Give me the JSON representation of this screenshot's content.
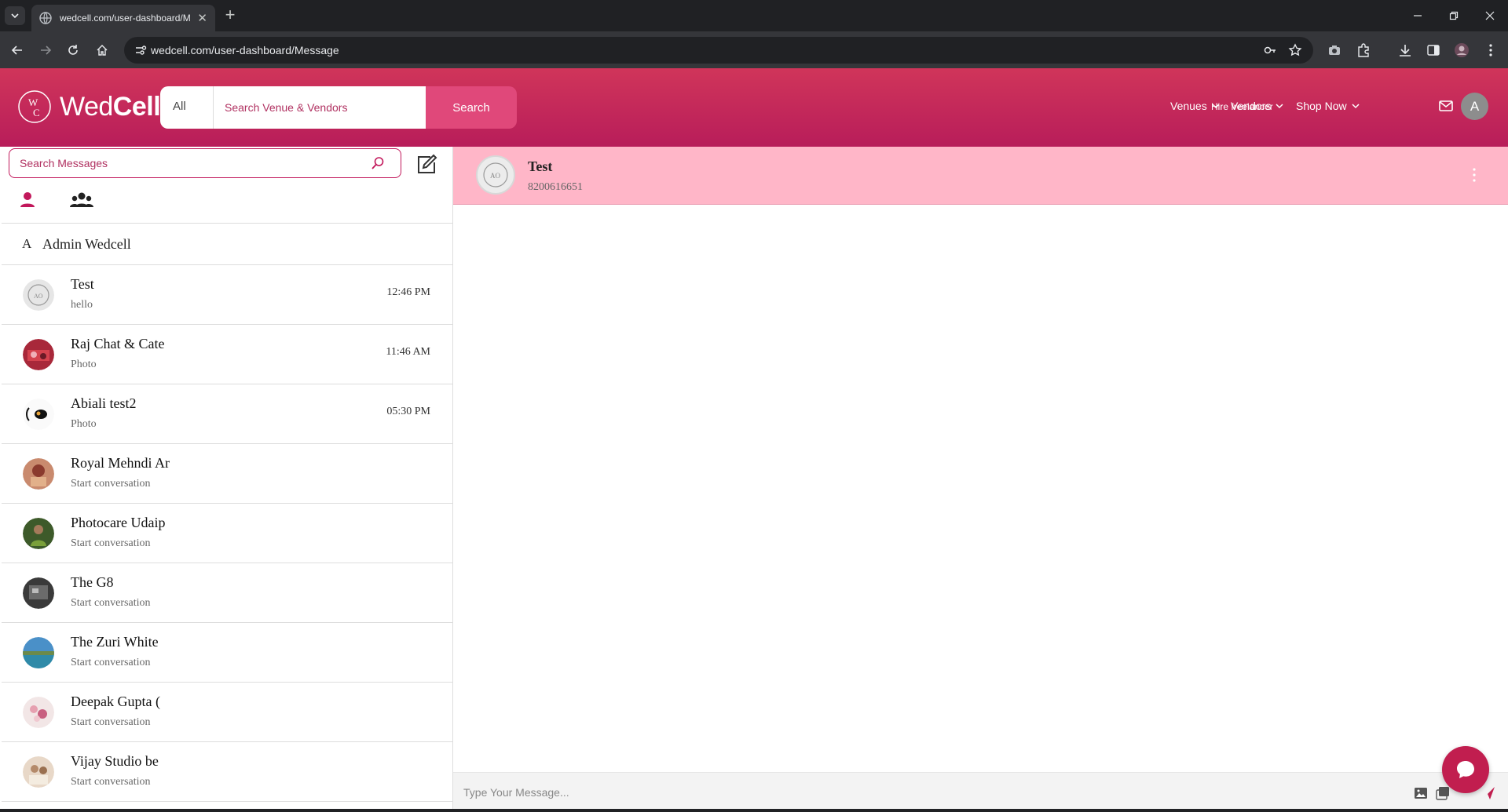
{
  "browser": {
    "tab_title": "wedcell.com/user-dashboard/M",
    "url": "wedcell.com/user-dashboard/Message"
  },
  "header": {
    "logo_text_light": "Wed",
    "logo_text_bold": "Cell",
    "search_category": "All",
    "search_placeholder": "Search Venue & Vendors",
    "search_button": "Search",
    "nav": [
      "Venues",
      "Vendors",
      "Shop Now"
    ],
    "hire_label": "Hire freelancer",
    "avatar_letter": "A"
  },
  "sidebar": {
    "search_placeholder": "Search Messages",
    "pinned": {
      "letter": "A",
      "name": "Admin Wedcell"
    },
    "conversations": [
      {
        "name": "Test",
        "preview": "hello",
        "time": "12:46 PM",
        "avatar": "ao-logo"
      },
      {
        "name": "Raj Chat & Cate",
        "preview": "Photo",
        "time": "11:46 AM",
        "avatar": "photo"
      },
      {
        "name": "Abiali test2",
        "preview": "Photo",
        "time": "05:30 PM",
        "avatar": "photo"
      },
      {
        "name": "Royal Mehndi Ar",
        "preview": "Start conversation",
        "time": "",
        "avatar": "photo"
      },
      {
        "name": "Photocare Udaip",
        "preview": "Start conversation",
        "time": "",
        "avatar": "photo"
      },
      {
        "name": "The G8",
        "preview": "Start conversation",
        "time": "",
        "avatar": "photo"
      },
      {
        "name": "The Zuri White",
        "preview": "Start conversation",
        "time": "",
        "avatar": "photo"
      },
      {
        "name": "Deepak Gupta (",
        "preview": "Start conversation",
        "time": "",
        "avatar": "photo"
      },
      {
        "name": "Vijay Studio be",
        "preview": "Start conversation",
        "time": "",
        "avatar": "photo"
      }
    ]
  },
  "chat": {
    "contact_name": "Test",
    "contact_phone": "8200616651",
    "composer_placeholder": "Type Your Message..."
  },
  "colors": {
    "brand": "#c11e4f",
    "header_gradient_top": "#d0355a",
    "chat_header_bg": "#ffb6c8"
  }
}
